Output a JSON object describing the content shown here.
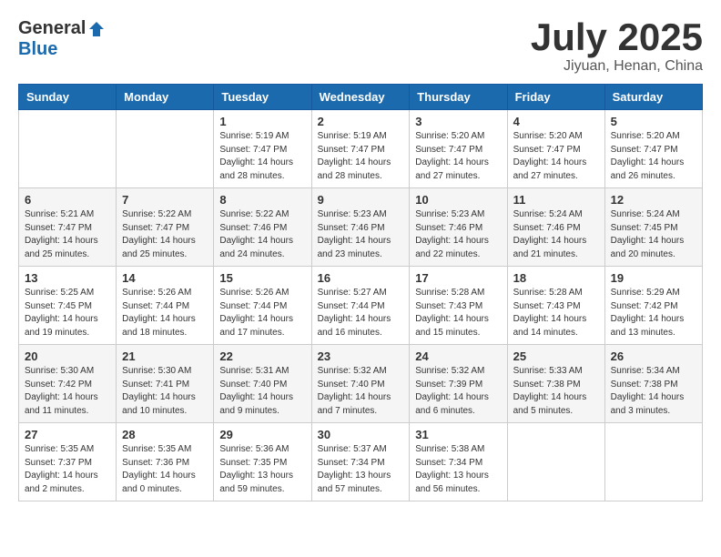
{
  "header": {
    "logo_general": "General",
    "logo_blue": "Blue",
    "month_title": "July 2025",
    "location": "Jiyuan, Henan, China"
  },
  "weekdays": [
    "Sunday",
    "Monday",
    "Tuesday",
    "Wednesday",
    "Thursday",
    "Friday",
    "Saturday"
  ],
  "weeks": [
    [
      {
        "day": "",
        "info": ""
      },
      {
        "day": "",
        "info": ""
      },
      {
        "day": "1",
        "info": "Sunrise: 5:19 AM\nSunset: 7:47 PM\nDaylight: 14 hours\nand 28 minutes."
      },
      {
        "day": "2",
        "info": "Sunrise: 5:19 AM\nSunset: 7:47 PM\nDaylight: 14 hours\nand 28 minutes."
      },
      {
        "day": "3",
        "info": "Sunrise: 5:20 AM\nSunset: 7:47 PM\nDaylight: 14 hours\nand 27 minutes."
      },
      {
        "day": "4",
        "info": "Sunrise: 5:20 AM\nSunset: 7:47 PM\nDaylight: 14 hours\nand 27 minutes."
      },
      {
        "day": "5",
        "info": "Sunrise: 5:20 AM\nSunset: 7:47 PM\nDaylight: 14 hours\nand 26 minutes."
      }
    ],
    [
      {
        "day": "6",
        "info": "Sunrise: 5:21 AM\nSunset: 7:47 PM\nDaylight: 14 hours\nand 25 minutes."
      },
      {
        "day": "7",
        "info": "Sunrise: 5:22 AM\nSunset: 7:47 PM\nDaylight: 14 hours\nand 25 minutes."
      },
      {
        "day": "8",
        "info": "Sunrise: 5:22 AM\nSunset: 7:46 PM\nDaylight: 14 hours\nand 24 minutes."
      },
      {
        "day": "9",
        "info": "Sunrise: 5:23 AM\nSunset: 7:46 PM\nDaylight: 14 hours\nand 23 minutes."
      },
      {
        "day": "10",
        "info": "Sunrise: 5:23 AM\nSunset: 7:46 PM\nDaylight: 14 hours\nand 22 minutes."
      },
      {
        "day": "11",
        "info": "Sunrise: 5:24 AM\nSunset: 7:46 PM\nDaylight: 14 hours\nand 21 minutes."
      },
      {
        "day": "12",
        "info": "Sunrise: 5:24 AM\nSunset: 7:45 PM\nDaylight: 14 hours\nand 20 minutes."
      }
    ],
    [
      {
        "day": "13",
        "info": "Sunrise: 5:25 AM\nSunset: 7:45 PM\nDaylight: 14 hours\nand 19 minutes."
      },
      {
        "day": "14",
        "info": "Sunrise: 5:26 AM\nSunset: 7:44 PM\nDaylight: 14 hours\nand 18 minutes."
      },
      {
        "day": "15",
        "info": "Sunrise: 5:26 AM\nSunset: 7:44 PM\nDaylight: 14 hours\nand 17 minutes."
      },
      {
        "day": "16",
        "info": "Sunrise: 5:27 AM\nSunset: 7:44 PM\nDaylight: 14 hours\nand 16 minutes."
      },
      {
        "day": "17",
        "info": "Sunrise: 5:28 AM\nSunset: 7:43 PM\nDaylight: 14 hours\nand 15 minutes."
      },
      {
        "day": "18",
        "info": "Sunrise: 5:28 AM\nSunset: 7:43 PM\nDaylight: 14 hours\nand 14 minutes."
      },
      {
        "day": "19",
        "info": "Sunrise: 5:29 AM\nSunset: 7:42 PM\nDaylight: 14 hours\nand 13 minutes."
      }
    ],
    [
      {
        "day": "20",
        "info": "Sunrise: 5:30 AM\nSunset: 7:42 PM\nDaylight: 14 hours\nand 11 minutes."
      },
      {
        "day": "21",
        "info": "Sunrise: 5:30 AM\nSunset: 7:41 PM\nDaylight: 14 hours\nand 10 minutes."
      },
      {
        "day": "22",
        "info": "Sunrise: 5:31 AM\nSunset: 7:40 PM\nDaylight: 14 hours\nand 9 minutes."
      },
      {
        "day": "23",
        "info": "Sunrise: 5:32 AM\nSunset: 7:40 PM\nDaylight: 14 hours\nand 7 minutes."
      },
      {
        "day": "24",
        "info": "Sunrise: 5:32 AM\nSunset: 7:39 PM\nDaylight: 14 hours\nand 6 minutes."
      },
      {
        "day": "25",
        "info": "Sunrise: 5:33 AM\nSunset: 7:38 PM\nDaylight: 14 hours\nand 5 minutes."
      },
      {
        "day": "26",
        "info": "Sunrise: 5:34 AM\nSunset: 7:38 PM\nDaylight: 14 hours\nand 3 minutes."
      }
    ],
    [
      {
        "day": "27",
        "info": "Sunrise: 5:35 AM\nSunset: 7:37 PM\nDaylight: 14 hours\nand 2 minutes."
      },
      {
        "day": "28",
        "info": "Sunrise: 5:35 AM\nSunset: 7:36 PM\nDaylight: 14 hours\nand 0 minutes."
      },
      {
        "day": "29",
        "info": "Sunrise: 5:36 AM\nSunset: 7:35 PM\nDaylight: 13 hours\nand 59 minutes."
      },
      {
        "day": "30",
        "info": "Sunrise: 5:37 AM\nSunset: 7:34 PM\nDaylight: 13 hours\nand 57 minutes."
      },
      {
        "day": "31",
        "info": "Sunrise: 5:38 AM\nSunset: 7:34 PM\nDaylight: 13 hours\nand 56 minutes."
      },
      {
        "day": "",
        "info": ""
      },
      {
        "day": "",
        "info": ""
      }
    ]
  ]
}
